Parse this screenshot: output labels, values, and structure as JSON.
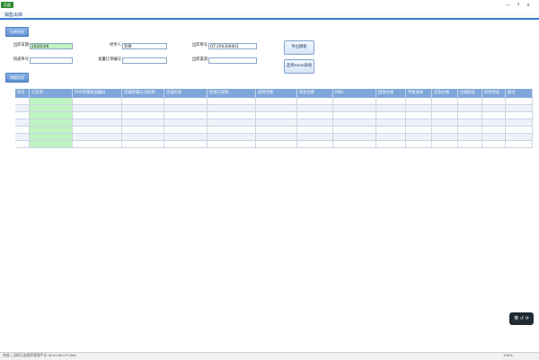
{
  "window": {
    "app_button": "页面",
    "tab_label": "销售出库"
  },
  "sections": {
    "outbound_info": "出库信息",
    "detail_info": "明细信息"
  },
  "form": {
    "date_label": "出库日期",
    "date_value": "2020/3/6",
    "handler_label": "经手人",
    "handler_value": "刘谢",
    "order_no_label": "出库单号",
    "order_no_value": "OT-200306001",
    "express_label": "快递单号",
    "express_value": "",
    "batch_label": "批量订单编号",
    "batch_value": "",
    "channel_label": "出库渠道",
    "channel_value": ""
  },
  "actions": {
    "export_template": "导出模板",
    "select_excel": "选择excel表格"
  },
  "table": {
    "columns": [
      "序号",
      "订货单",
      "POP店铺商品编码",
      "店铺所属公司机构",
      "店铺名称",
      "检测工程师",
      "品牌名称",
      "机型名称",
      "IMEI",
      "回收价格",
      "手机成本",
      "出货价格",
      "仓储状态",
      "库存状态",
      "备注"
    ],
    "row_count": 7
  },
  "floating_widget": {
    "label": "英 ↺ ⟳"
  },
  "statusbar": {
    "left_text": "完成 | 当前已连接到管理平台 ID:4146213 (86)",
    "zoom": "100%"
  }
}
